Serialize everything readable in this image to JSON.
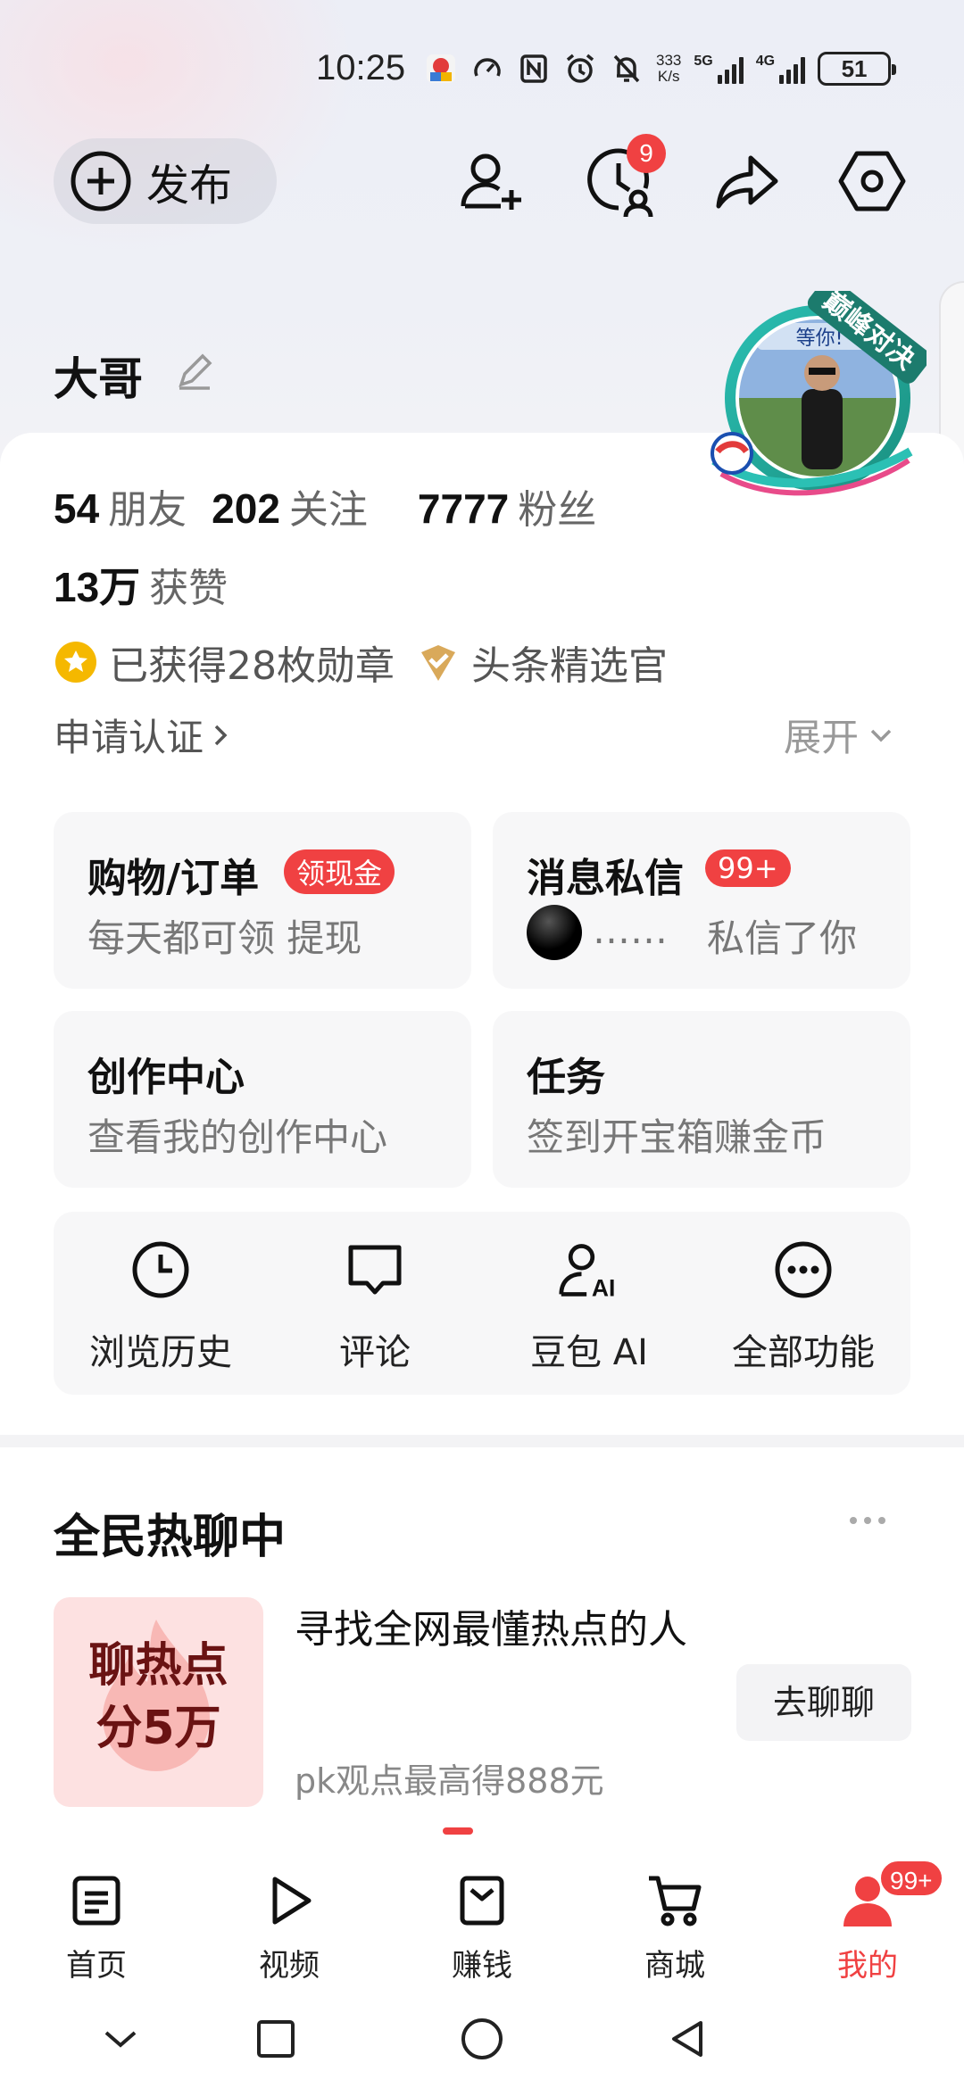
{
  "status_bar": {
    "time": "10:25",
    "net_speed_top": "333",
    "net_speed_bottom": "K/s",
    "sim1": "5G",
    "sim2": "4G",
    "battery": "51"
  },
  "header": {
    "publish_label": "发布",
    "history_badge": "9",
    "icons": [
      "add-friend-icon",
      "history-icon",
      "share-icon",
      "settings-icon"
    ]
  },
  "profile": {
    "name": "大哥",
    "avatar_banner": "巅峰对决",
    "avatar_text": "等你!",
    "friends_count": "54",
    "friends_label": "朋友",
    "following_count": "202",
    "following_label": "关注",
    "fans_count": "7777",
    "fans_label": "粉丝",
    "likes_count": "13万",
    "likes_label": "获赞",
    "medals_label": "已获得28枚勋章",
    "curator_label": "头条精选官",
    "apply_verify": "申请认证",
    "expand": "展开"
  },
  "tiles": {
    "shopping": {
      "title": "购物/订单",
      "pill": "领现金",
      "subtitle": "每天都可领 提现"
    },
    "messages": {
      "title": "消息私信",
      "badge": "99+",
      "sender": "……",
      "subtitle": "私信了你"
    },
    "creator": {
      "title": "创作中心",
      "subtitle": "查看我的创作中心"
    },
    "tasks": {
      "title": "任务",
      "subtitle": "签到开宝箱赚金币"
    }
  },
  "tools": [
    {
      "label": "浏览历史",
      "icon": "clock-icon"
    },
    {
      "label": "评论",
      "icon": "comment-icon"
    },
    {
      "label": "豆包 AI",
      "icon": "ai-assistant-icon"
    },
    {
      "label": "全部功能",
      "icon": "more-icon"
    }
  ],
  "hot_section": {
    "title": "全民热聊中",
    "card_line1": "聊热点",
    "card_line2": "分5万",
    "headline": "寻找全网最懂热点的人",
    "subtitle": "pk观点最高得888元",
    "button": "去聊聊"
  },
  "bottom_nav": {
    "items": [
      {
        "label": "首页",
        "icon": "home-icon"
      },
      {
        "label": "视频",
        "icon": "video-icon"
      },
      {
        "label": "赚钱",
        "icon": "earn-icon"
      },
      {
        "label": "商城",
        "icon": "cart-icon"
      },
      {
        "label": "我的",
        "icon": "profile-icon"
      }
    ],
    "profile_badge": "99+",
    "active": "我的"
  },
  "colors": {
    "accent_red": "#f04142",
    "medal_gold": "#f5b800",
    "tile_bg": "#f7f7f8"
  }
}
